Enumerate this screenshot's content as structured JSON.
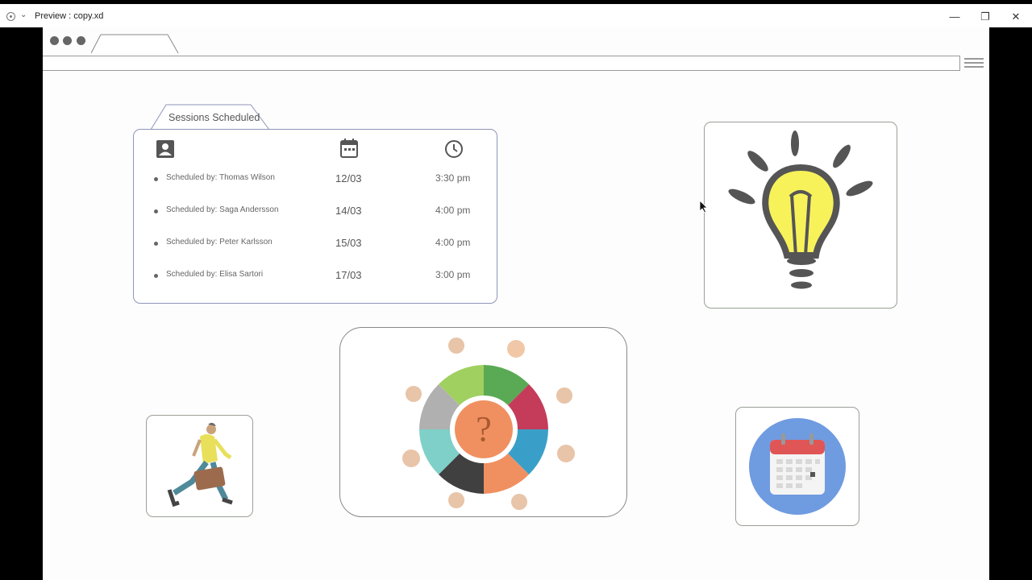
{
  "window": {
    "title": "Preview : copy.xd",
    "controls": {
      "minimize": "—",
      "restore": "❐",
      "close": "✕"
    }
  },
  "sessions": {
    "tab_label": "Sessions Scheduled",
    "header_icons": [
      "contact-card-icon",
      "calendar-icon",
      "clock-icon"
    ],
    "rows": [
      {
        "scheduled_by": "Scheduled by: Thomas Wilson",
        "date": "12/03",
        "time": "3:30 pm"
      },
      {
        "scheduled_by": "Scheduled by: Saga Andersson",
        "date": "14/03",
        "time": "4:00 pm"
      },
      {
        "scheduled_by": "Scheduled by: Peter Karlsson",
        "date": "15/03",
        "time": "4:00 pm"
      },
      {
        "scheduled_by": "Scheduled by: Elisa Sartori",
        "date": "17/03",
        "time": "3:00 pm"
      }
    ]
  },
  "illustrations": [
    "lightbulb-illustration",
    "running-man-illustration",
    "people-circle-question-illustration",
    "calendar-illustration"
  ],
  "colors": {
    "panel_border": "#8f95b8",
    "bulb_yellow": "#f8f25a",
    "calendar_bg": "#6f9be0",
    "calendar_red": "#e05555"
  }
}
